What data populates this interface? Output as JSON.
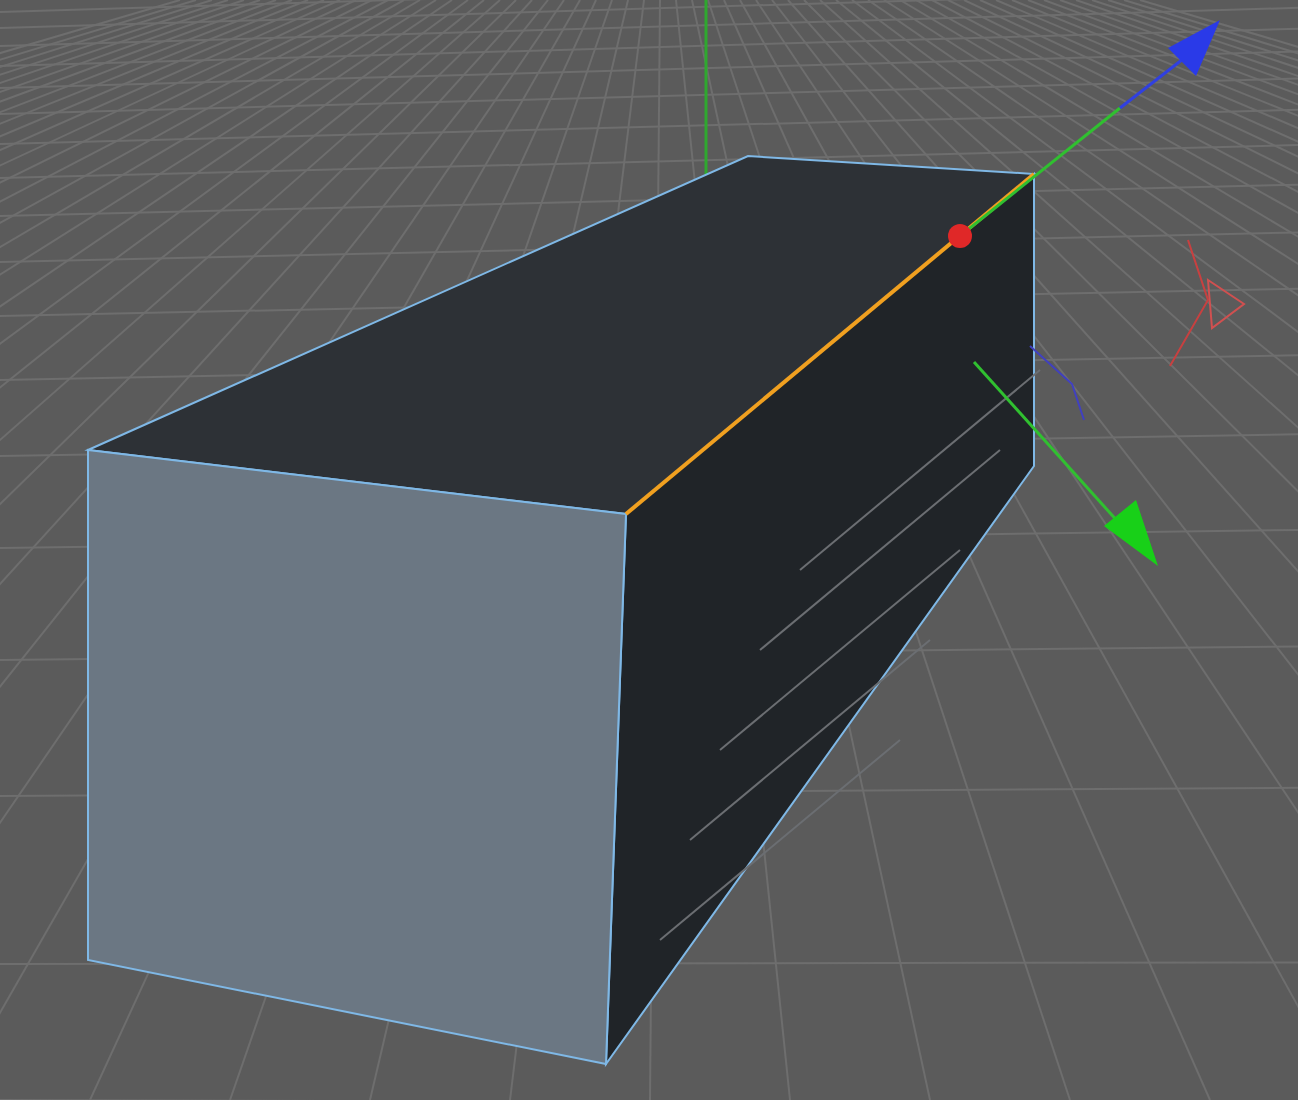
{
  "viewport": {
    "grid": true
  },
  "object": {
    "kind": "box",
    "selected": true
  },
  "edge": {
    "selected": true
  }
}
